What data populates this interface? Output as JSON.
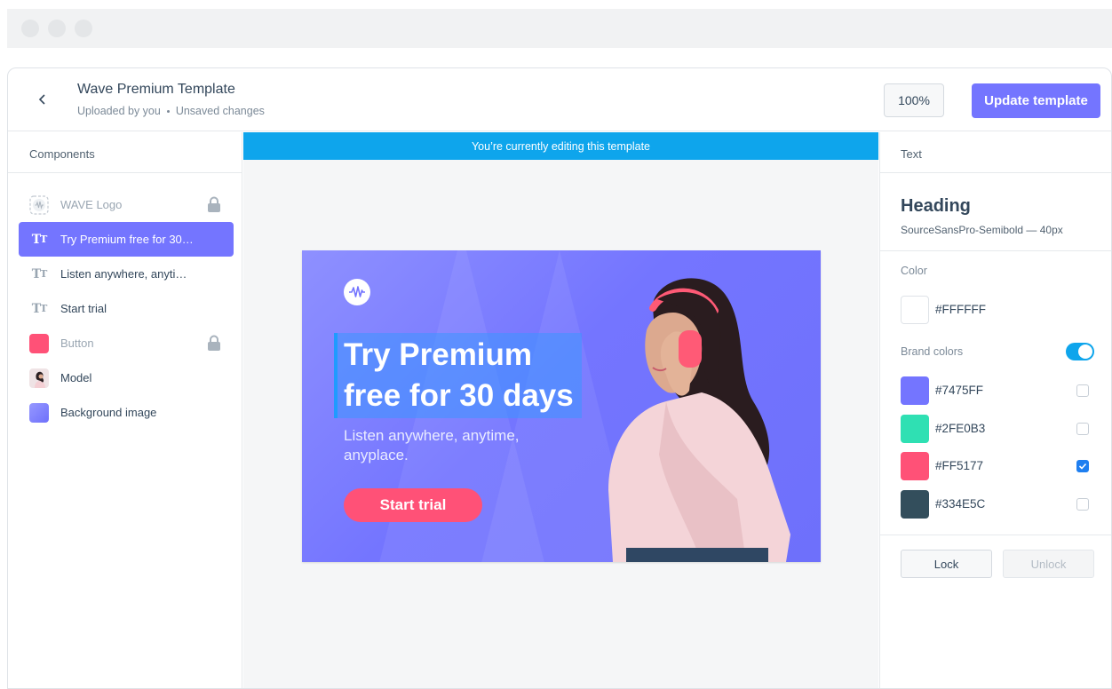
{
  "window": {
    "title": "Wave Premium Template",
    "uploaded_by": "Uploaded by you",
    "status": "Unsaved changes"
  },
  "toolbar": {
    "zoom": "100%",
    "update_label": "Update template"
  },
  "components": {
    "header": "Components",
    "items": [
      {
        "label": "WAVE Logo",
        "icon": "wave-logo-icon",
        "locked": true,
        "muted": true
      },
      {
        "label": "Try Premium free for 30…",
        "icon": "text-icon",
        "active": true
      },
      {
        "label": "Listen anywhere, anyti…",
        "icon": "text-icon"
      },
      {
        "label": "Start trial",
        "icon": "text-icon"
      },
      {
        "label": "Button",
        "icon": "button-swatch-icon",
        "locked": true,
        "muted": true
      },
      {
        "label": "Model",
        "icon": "model-thumbnail-icon"
      },
      {
        "label": "Background image",
        "icon": "background-thumbnail-icon"
      }
    ]
  },
  "canvas": {
    "banner": "You’re currently editing this template",
    "art": {
      "heading": "Try Premium free for 30 days",
      "subheading": "Listen anywhere, anytime, anyplace.",
      "cta": "Start trial"
    }
  },
  "text_panel": {
    "header": "Text",
    "style_name": "Heading",
    "font_info": "SourceSansPro-Semibold — 40px",
    "color_label": "Color",
    "current_color": "#FFFFFF",
    "brand_colors_label": "Brand colors",
    "brand_colors_enabled": true,
    "brand_colors": [
      {
        "hex": "#7475FF",
        "checked": false
      },
      {
        "hex": "#2FE0B3",
        "checked": false
      },
      {
        "hex": "#FF5177",
        "checked": true
      },
      {
        "hex": "#334E5C",
        "checked": false
      }
    ],
    "lock_label": "Lock",
    "unlock_label": "Unlock"
  },
  "colors": {
    "accent": "#7475FF",
    "banner_blue": "#0EA5EC",
    "cta_pink": "#FF5177"
  }
}
